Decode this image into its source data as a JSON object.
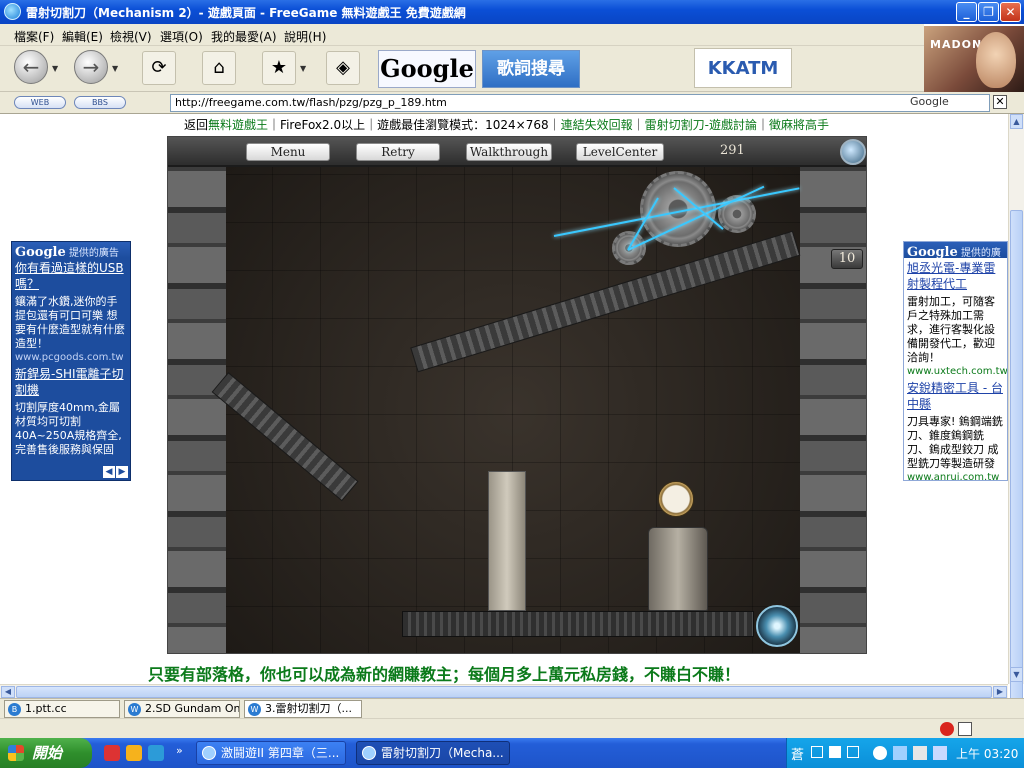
{
  "window": {
    "title": "雷射切割刀（Mechanism 2）- 遊戲頁面 - FreeGame 無料遊戲王 免費遊戲網"
  },
  "menu": [
    "檔案(F)",
    "編輯(E)",
    "檢視(V)",
    "選項(O)",
    "我的最愛(A)",
    "說明(H)"
  ],
  "toolbar": {
    "google_label": "Google",
    "lyrics_label": "歌詞搜尋",
    "kkatm_label": "KKATM"
  },
  "madonna_ad": {
    "name": "MADONNA"
  },
  "address": {
    "web_pill": "WEB",
    "bbs_pill": "BBS",
    "url": "http://freegame.com.tw/flash/pzg/pzg_p_189.htm",
    "google_label": "Google"
  },
  "top_links": {
    "back": "返回",
    "site": "無料遊戲王",
    "sep1": "｜",
    "firefox": "FireFox2.0以上",
    "sep2": "｜",
    "best_mode": "遊戲最佳瀏覽模式：1024×768",
    "sep3": "｜",
    "report": "連結失效回報",
    "sep4": "｜",
    "discuss": "雷射切割刀-遊戲討論",
    "sep5": "｜",
    "mahjong": "徵麻將高手"
  },
  "game": {
    "menu_btn": "Menu",
    "retry_btn": "Retry",
    "walkthrough_btn": "Walkthrough",
    "levelcenter_btn": "LevelCenter",
    "score": "291",
    "counter": "10"
  },
  "left_ad": {
    "header_brand": "Google",
    "header_text": "提供的廣告",
    "items": [
      {
        "title": "你有看過這樣的USB嗎？",
        "desc": "鑲滿了水鑽,迷你的手提包還有可口可樂 想要有什麼造型就有什麼造型！",
        "url": "www.pcgoods.com.tw"
      },
      {
        "title": "新銲易-SHI電離子切割機",
        "desc": "切割厚度40mm,金屬材質均可切割 40A~250A規格齊全,完善售後服務與保固",
        "url": ""
      }
    ]
  },
  "right_ad": {
    "header_brand": "Google",
    "header_text": "提供的廣告",
    "items": [
      {
        "title": "旭丞光電-專業雷射製程代工",
        "desc": "雷射加工，可隨客戶之特殊加工需求，進行客製化設備開發代工，歡迎洽詢！",
        "url": "www.uxtech.com.tw"
      },
      {
        "title": "安銳精密工具 - 台中縣",
        "desc": "刀具專家! 鎢鋼端銑刀、錐度鎢鋼銑刀、鎢成型鉸刀 成型銑刀等製造研發",
        "url": "www.anrui.com.tw"
      }
    ]
  },
  "promo": "只要有部落格，你也可以成為新的網賺教主；每個月多上萬元私房錢，不賺白不賺！",
  "status_tabs": [
    {
      "label": "1.ptt.cc"
    },
    {
      "label": "2.SD Gundam On..."
    },
    {
      "label": "3.雷射切割刀（..."
    }
  ],
  "taskbar": {
    "start": "開始",
    "tasks": [
      {
        "label": "激鬪遊II 第四章（三..."
      },
      {
        "label": "雷射切割刀（Mecha..."
      }
    ],
    "clock": "上午 03:20",
    "ime": "蒼"
  }
}
